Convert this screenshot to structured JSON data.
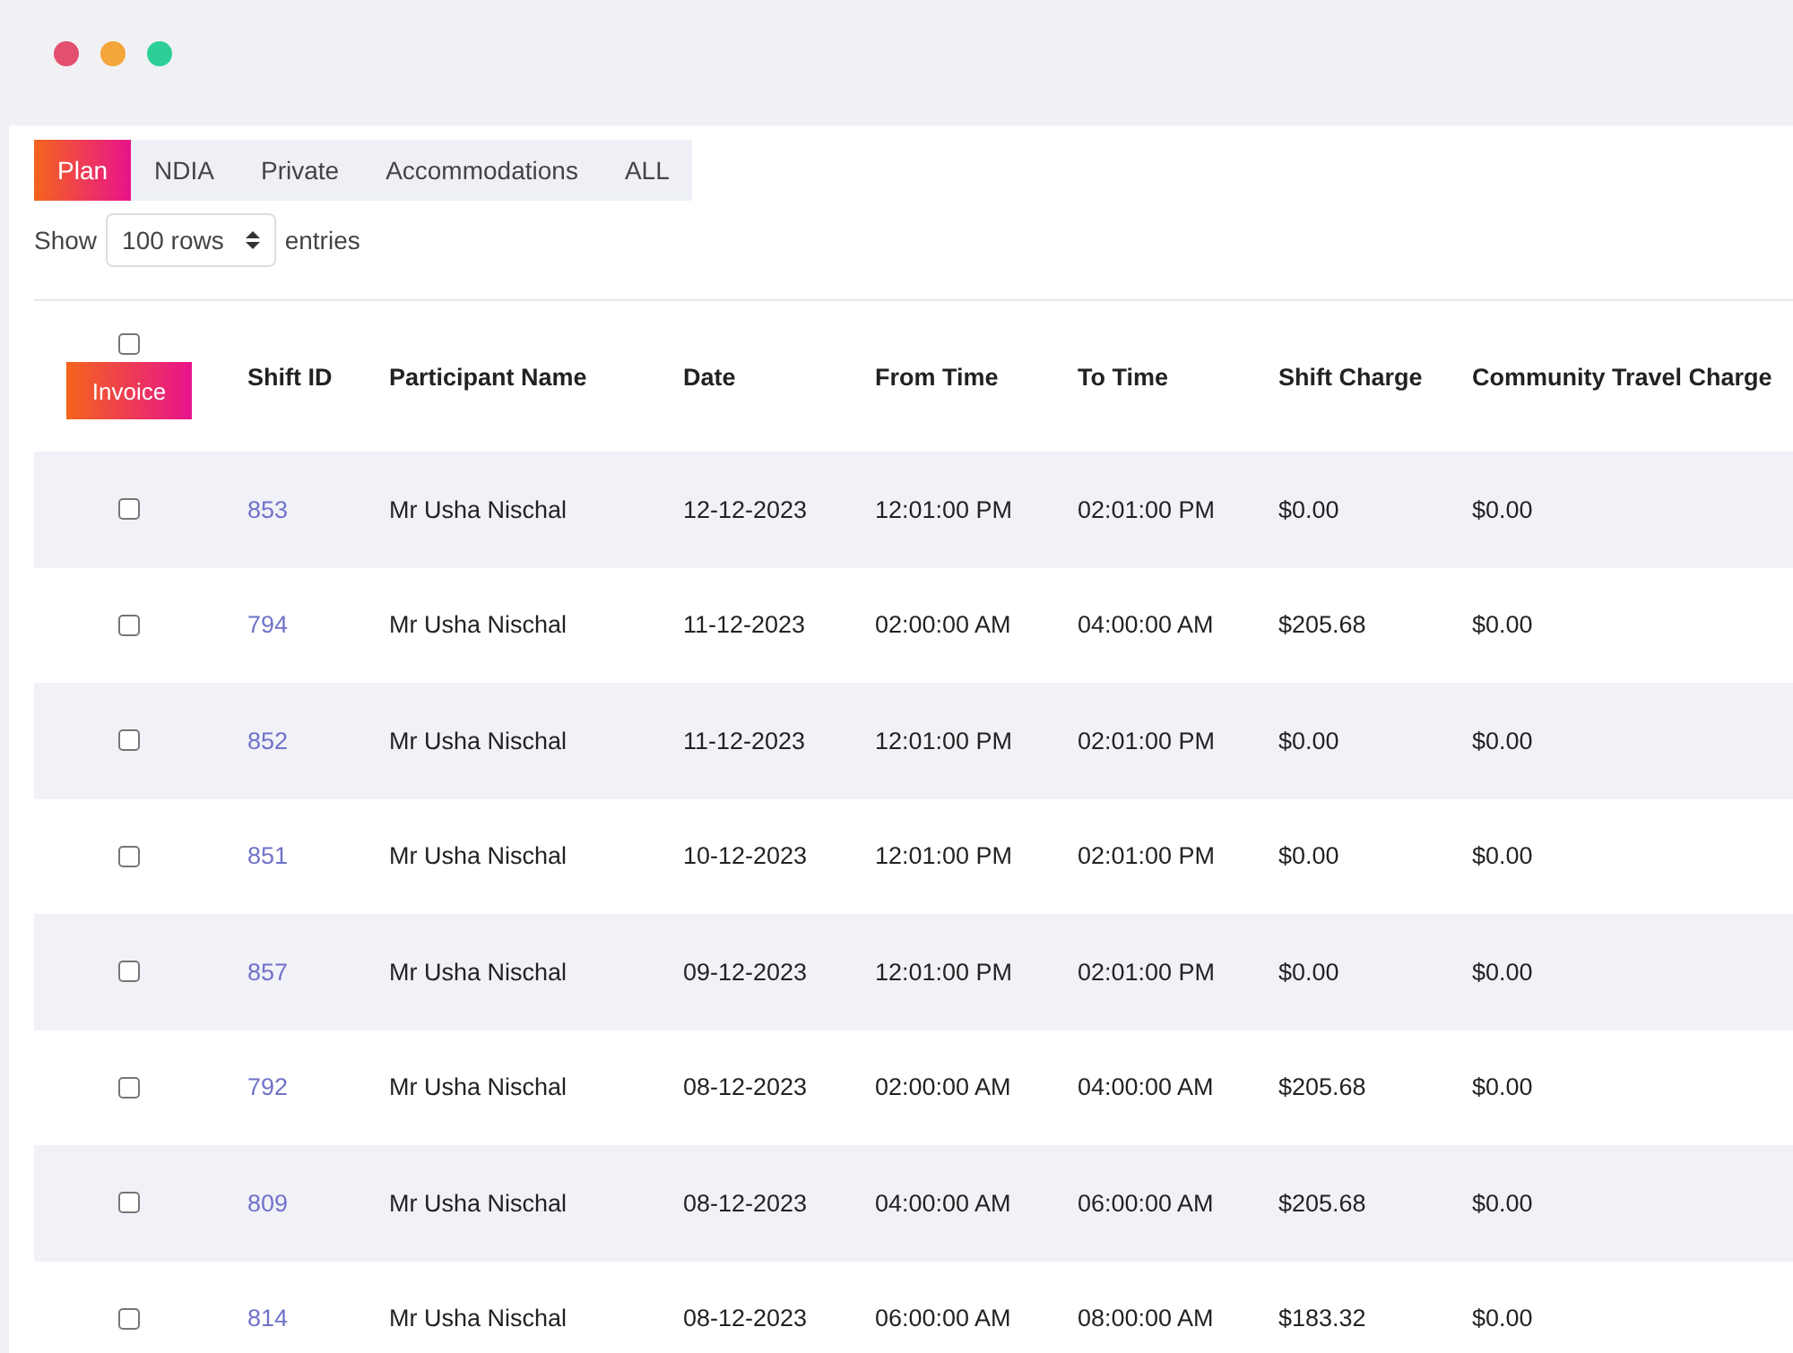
{
  "tabs": [
    {
      "label": "Plan",
      "selected": true
    },
    {
      "label": "NDIA",
      "selected": false
    },
    {
      "label": "Private",
      "selected": false
    },
    {
      "label": "Accommodations",
      "selected": false
    },
    {
      "label": "ALL",
      "selected": false
    }
  ],
  "length_control": {
    "prefix": "Show",
    "value": "100 rows",
    "suffix": "entries"
  },
  "table": {
    "select_all_checked": false,
    "invoice_button": "Invoice",
    "columns": [
      "Shift ID",
      "Participant Name",
      "Date",
      "From Time",
      "To Time",
      "Shift Charge",
      "Community Travel Charge"
    ],
    "rows": [
      {
        "checked": false,
        "cells": [
          "853",
          "Mr Usha Nischal",
          "12-12-2023",
          "12:01:00 PM",
          "02:01:00 PM",
          "$0.00",
          "$0.00"
        ]
      },
      {
        "checked": false,
        "cells": [
          "794",
          "Mr Usha Nischal",
          "11-12-2023",
          "02:00:00 AM",
          "04:00:00 AM",
          "$205.68",
          "$0.00"
        ]
      },
      {
        "checked": false,
        "cells": [
          "852",
          "Mr Usha Nischal",
          "11-12-2023",
          "12:01:00 PM",
          "02:01:00 PM",
          "$0.00",
          "$0.00"
        ]
      },
      {
        "checked": false,
        "cells": [
          "851",
          "Mr Usha Nischal",
          "10-12-2023",
          "12:01:00 PM",
          "02:01:00 PM",
          "$0.00",
          "$0.00"
        ]
      },
      {
        "checked": false,
        "cells": [
          "857",
          "Mr Usha Nischal",
          "09-12-2023",
          "12:01:00 PM",
          "02:01:00 PM",
          "$0.00",
          "$0.00"
        ]
      },
      {
        "checked": false,
        "cells": [
          "792",
          "Mr Usha Nischal",
          "08-12-2023",
          "02:00:00 AM",
          "04:00:00 AM",
          "$205.68",
          "$0.00"
        ]
      },
      {
        "checked": false,
        "cells": [
          "809",
          "Mr Usha Nischal",
          "08-12-2023",
          "04:00:00 AM",
          "06:00:00 AM",
          "$205.68",
          "$0.00"
        ]
      },
      {
        "checked": false,
        "cells": [
          "814",
          "Mr Usha Nischal",
          "08-12-2023",
          "06:00:00 AM",
          "08:00:00 AM",
          "$183.32",
          "$0.00"
        ]
      }
    ]
  }
}
